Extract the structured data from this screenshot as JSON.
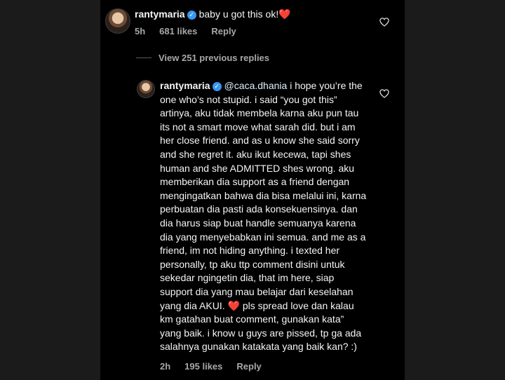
{
  "comment": {
    "username": "rantymaria",
    "text": "baby u got this ok!",
    "emoji": "❤️",
    "time": "5h",
    "likes": "681 likes",
    "reply_label": "Reply"
  },
  "view_replies_label": "View 251 previous replies",
  "reply": {
    "username": "rantymaria",
    "mention": "@caca.dhania",
    "text_part1": " i hope you’re the one who’s not stupid. i said “you got this” artinya, aku tidak membela karna aku pun tau its not a smart move what sarah did. but i am her close friend. and as u know she said sorry and she regret it. aku ikut kecewa, tapi shes human and she ADMITTED shes wrong. aku memberikan dia support as a friend dengan mengingatkan bahwa dia bisa melalui ini, karna perbuatan dia pasti ada konsekuensinya. dan dia harus siap buat handle semuanya karena dia yang menyebabkan ini semua. and me as a friend, im not hiding anything. i texted her personally, tp aku ttp comment disini untuk sekedar ngingetin dia, that im here, siap support dia yang mau belajar dari keselahan yang dia AKUI.",
    "emoji": "❤️",
    "text_part2": " pls spread love dan kalau km gatahan buat comment, gunakan kata” yang baik. i know u guys are pissed, tp ga ada salahnya gunakan katakata yang baik kan? :)",
    "time": "2h",
    "likes": "195 likes",
    "reply_label": "Reply"
  },
  "icons": {
    "verified": "verified-badge-icon",
    "like": "heart-outline-icon"
  },
  "colors": {
    "background": "#000000",
    "text": "#f5f5f5",
    "secondary": "#a8a8a8",
    "verified": "#3897f0",
    "heart": "#e8243c"
  }
}
